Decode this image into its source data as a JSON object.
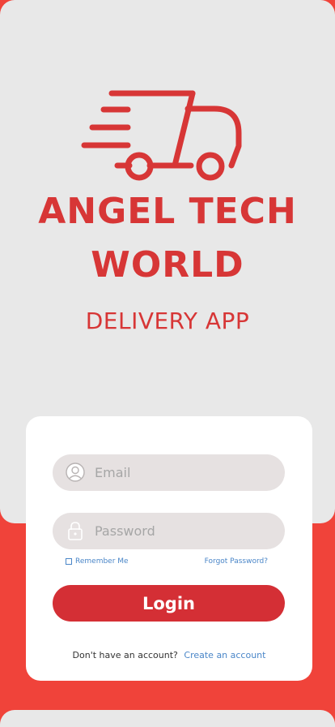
{
  "brand": {
    "title": "ANGEL TECH\nWORLD",
    "subtitle": "DELIVERY APP",
    "logo_icon": "delivery-truck-icon",
    "accent_color": "#d73636"
  },
  "login": {
    "email_placeholder": "Email",
    "password_placeholder": "Password",
    "email_icon": "user-icon",
    "password_icon": "lock-icon",
    "remember_label": "Remember Me",
    "forgot_label": "Forgot Password?",
    "login_button": "Login",
    "signup_prompt": "Don't have an account?",
    "signup_link": "Create an account"
  },
  "colors": {
    "background": "#f0433a",
    "panel": "#e8e8e8",
    "button": "#d42f35",
    "link": "#4a86c8"
  }
}
